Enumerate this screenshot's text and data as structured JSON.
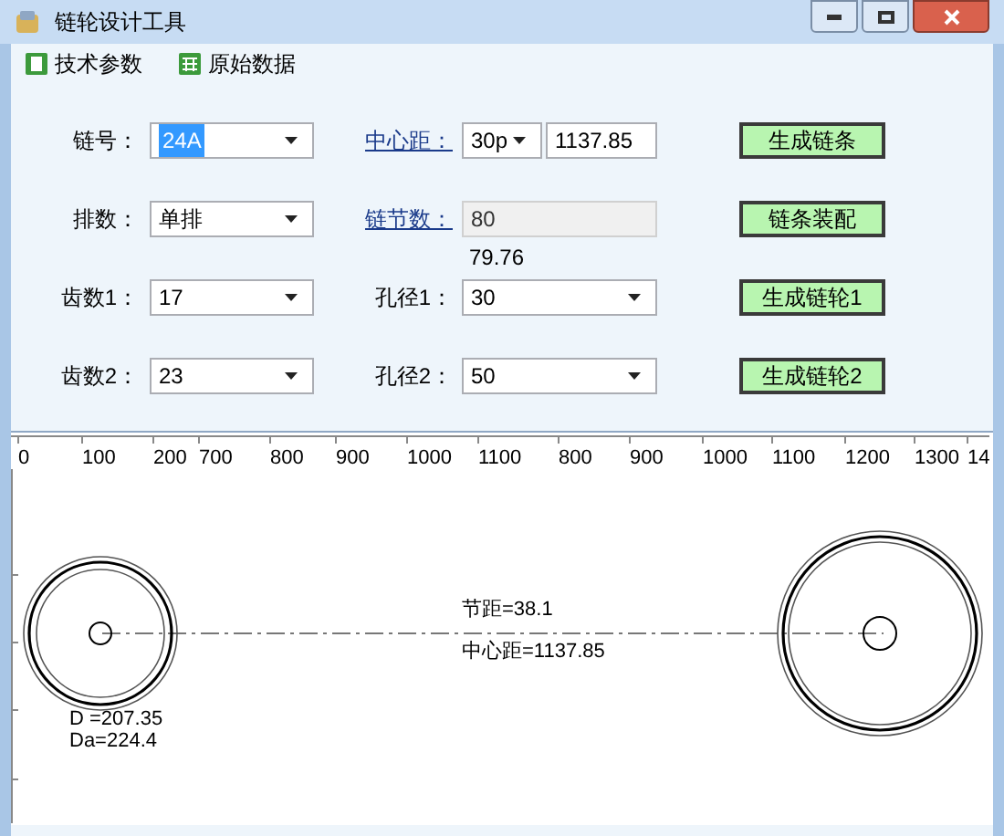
{
  "window": {
    "title": "链轮设计工具"
  },
  "toolbar": [
    {
      "label": "技术参数"
    },
    {
      "label": "原始数据"
    }
  ],
  "left_fields": [
    {
      "label": "链号：",
      "value": "24A",
      "highlighted": true
    },
    {
      "label": "排数：",
      "value": "单排",
      "highlighted": false
    },
    {
      "label": "齿数1：",
      "value": "17",
      "highlighted": false
    },
    {
      "label": "齿数2：",
      "value": "23",
      "highlighted": false
    }
  ],
  "right_fields": [
    {
      "kind": "combo_input",
      "label": "中心距：",
      "link": true,
      "value": "30p",
      "input": "1137.85"
    },
    {
      "kind": "readonly",
      "label": "链节数：",
      "link": true,
      "value": "80",
      "note": "79.76"
    },
    {
      "kind": "combo",
      "label": "孔径1：",
      "link": false,
      "value": "30"
    },
    {
      "kind": "combo",
      "label": "孔径2：",
      "link": false,
      "value": "50"
    }
  ],
  "buttons": [
    "生成链条",
    "链条装配",
    "生成链轮1",
    "生成链轮2"
  ],
  "ruler": [
    "0",
    "100",
    "200",
    "700",
    "800",
    "900",
    "1000",
    "1100",
    "800",
    "900",
    "1000",
    "1100",
    "1200",
    "1300",
    "14"
  ],
  "drawing": {
    "pitch": "节距=38.1",
    "center_distance": "中心距=1137.85",
    "d": "D =207.35",
    "da": "Da=224.4"
  }
}
